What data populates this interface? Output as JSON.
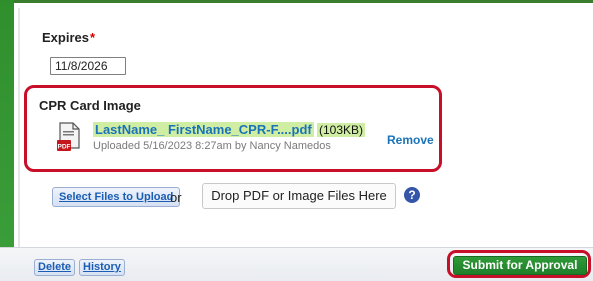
{
  "expires": {
    "label": "Expires",
    "required_marker": "*",
    "value": "11/8/2026"
  },
  "cpr_card": {
    "title": "CPR Card Image",
    "file": {
      "name": "LastName_ FirstName_CPR-F....pdf",
      "size": "(103KB)",
      "meta": "Uploaded 5/16/2023 8:27am by Nancy Namedos",
      "remove_label": "Remove",
      "icon": "pdf-file-icon"
    }
  },
  "upload": {
    "select_label": "Select Files to Upload",
    "or_text": "or",
    "drop_label": "Drop PDF or Image Files Here",
    "help_glyph": "?"
  },
  "footer": {
    "delete_label": "Delete",
    "history_label": "History",
    "submit_label": "Submit for Approval"
  },
  "colors": {
    "accent_green": "#2f8f2c",
    "highlight_red": "#c70f2a",
    "link_blue": "#1a73b8",
    "file_highlight": "#cfeea3"
  }
}
